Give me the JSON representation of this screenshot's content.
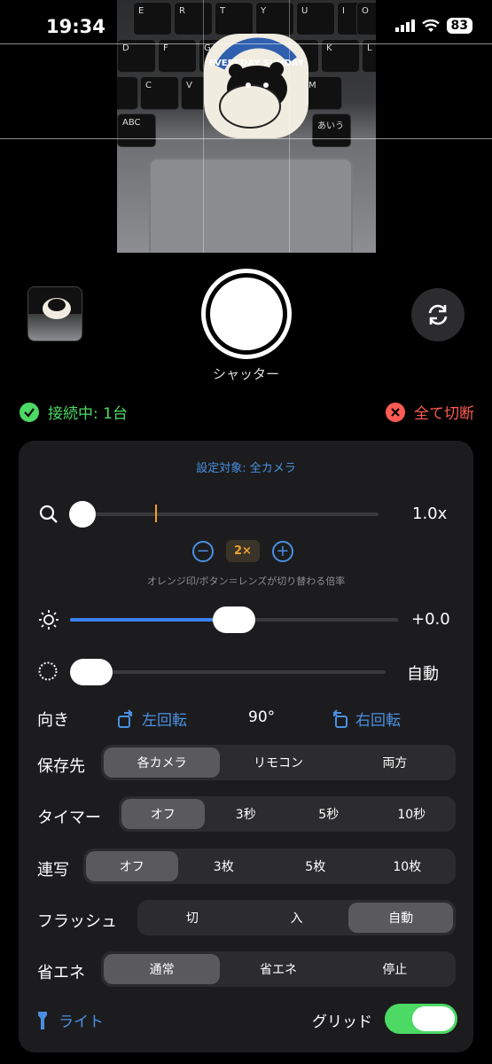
{
  "status_bar": {
    "time": "19:34",
    "battery": "83"
  },
  "preview_keys": [
    "E",
    "R",
    "T",
    "Y",
    "U",
    "I",
    "O",
    "P",
    "D",
    "F",
    "G",
    "H",
    "J",
    "K",
    "L",
    "X",
    "C",
    "V",
    "B",
    "N",
    "M",
    "ABC",
    "あいう"
  ],
  "sticker_text": "EVERYDAY SUNDAY",
  "shutter_label": "シャッター",
  "connection": {
    "status": "接続中: 1台",
    "disconnect_all": "全て切断"
  },
  "panel": {
    "target": "設定対象: 全カメラ",
    "zoom": {
      "value": "1.0x",
      "preset": "2×",
      "note": "オレンジ印/ボタン＝レンズが切り替わる倍率",
      "minus": "−",
      "plus": "+"
    },
    "exposure": {
      "value": "+0.0",
      "level": 0.5
    },
    "focus": {
      "value": "自動"
    },
    "orientation": {
      "label": "向き",
      "rotate_left": "左回転",
      "angle": "90°",
      "rotate_right": "右回転"
    },
    "save_to": {
      "label": "保存先",
      "options": [
        "各カメラ",
        "リモコン",
        "両方"
      ],
      "selected": 0
    },
    "timer": {
      "label": "タイマー",
      "options": [
        "オフ",
        "3秒",
        "5秒",
        "10秒"
      ],
      "selected": 0
    },
    "burst": {
      "label": "連写",
      "options": [
        "オフ",
        "3枚",
        "5枚",
        "10枚"
      ],
      "selected": 0
    },
    "flash": {
      "label": "フラッシュ",
      "options": [
        "切",
        "入",
        "自動"
      ],
      "selected": 2
    },
    "power": {
      "label": "省エネ",
      "options": [
        "通常",
        "省エネ",
        "停止"
      ],
      "selected": 0
    },
    "light_label": "ライト",
    "grid": {
      "label": "グリッド",
      "on": true
    }
  },
  "colors": {
    "accent": "#4a90e2",
    "connected": "#4cd964",
    "disconnect": "#ff5b54",
    "zoom_marker": "#f0a030",
    "exposure_fill": "#3b82f6"
  }
}
